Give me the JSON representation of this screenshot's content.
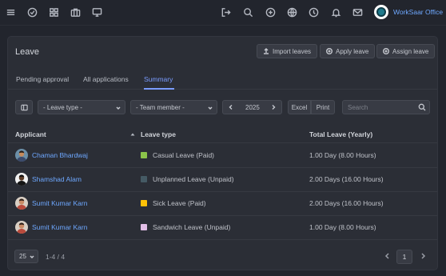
{
  "topbar": {
    "left_icons": [
      "menu-icon",
      "check-circle-icon",
      "grid-icon",
      "briefcase-icon",
      "monitor-icon"
    ],
    "right_icons": [
      "logout-icon",
      "search-icon",
      "plus-circle-icon",
      "globe-icon",
      "clock-icon",
      "bell-icon",
      "mail-icon"
    ],
    "brand_name": "WorkSaar Office"
  },
  "page": {
    "title": "Leave",
    "buttons": {
      "import": "Import leaves",
      "apply": "Apply leave",
      "assign": "Assign leave"
    },
    "tabs": [
      {
        "label": "Pending approval"
      },
      {
        "label": "All applications"
      },
      {
        "label": "Summary"
      }
    ],
    "active_tab": "Summary"
  },
  "filters": {
    "leave_type": "- Leave type -",
    "team_member": "- Team member -",
    "year": "2025",
    "excel": "Excel",
    "print": "Print",
    "search_placeholder": "Search"
  },
  "table": {
    "headers": {
      "applicant": "Applicant",
      "leave_type": "Leave type",
      "total": "Total Leave (Yearly)"
    },
    "rows": [
      {
        "applicant": "Chaman Bhardwaj",
        "leave_type": "Casual Leave (Paid)",
        "color": "#8bc34a",
        "total": "1.00 Day (8.00 Hours)"
      },
      {
        "applicant": "Shamshad Alam",
        "leave_type": "Unplanned Leave (Unpaid)",
        "color": "#455a64",
        "total": "2.00 Days (16.00 Hours)"
      },
      {
        "applicant": "Sumit Kumar Karn",
        "leave_type": "Sick Leave (Paid)",
        "color": "#ffc107",
        "total": "2.00 Days (16.00 Hours)"
      },
      {
        "applicant": "Sumit Kumar Karn",
        "leave_type": "Sandwich Leave (Unpaid)",
        "color": "#e1bee7",
        "total": "1.00 Day (8.00 Hours)"
      }
    ]
  },
  "pagination": {
    "page_size": "25",
    "range": "1-4 / 4",
    "current_page": "1"
  }
}
